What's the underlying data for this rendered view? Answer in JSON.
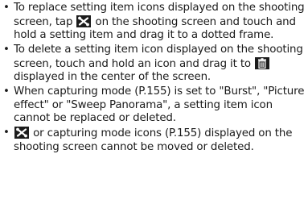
{
  "bullet_char": "•",
  "notes": [
    {
      "before": "To replace setting item icons displayed on the shooting screen, tap ",
      "icon": "tools-icon",
      "after": " on the shooting screen and touch and hold a setting item and drag it to a dotted frame."
    },
    {
      "before": "To delete a setting item icon displayed on the shooting screen, touch and hold an icon and drag it to ",
      "icon": "trash-icon",
      "after": " displayed in the center of the screen."
    },
    {
      "text": "When capturing mode (P.155) is set to \"Burst\", \"Picture effect\" or \"Sweep Panorama\", a setting item icon cannot be replaced or deleted."
    },
    {
      "icon": "tools-icon",
      "after": " or capturing mode icons (P.155) displayed on the shooting screen cannot be moved or deleted."
    }
  ],
  "colors": {
    "text": "#1a1a1a",
    "icon_bg": "#1c1c1c",
    "icon_fg": "#ffffff"
  }
}
